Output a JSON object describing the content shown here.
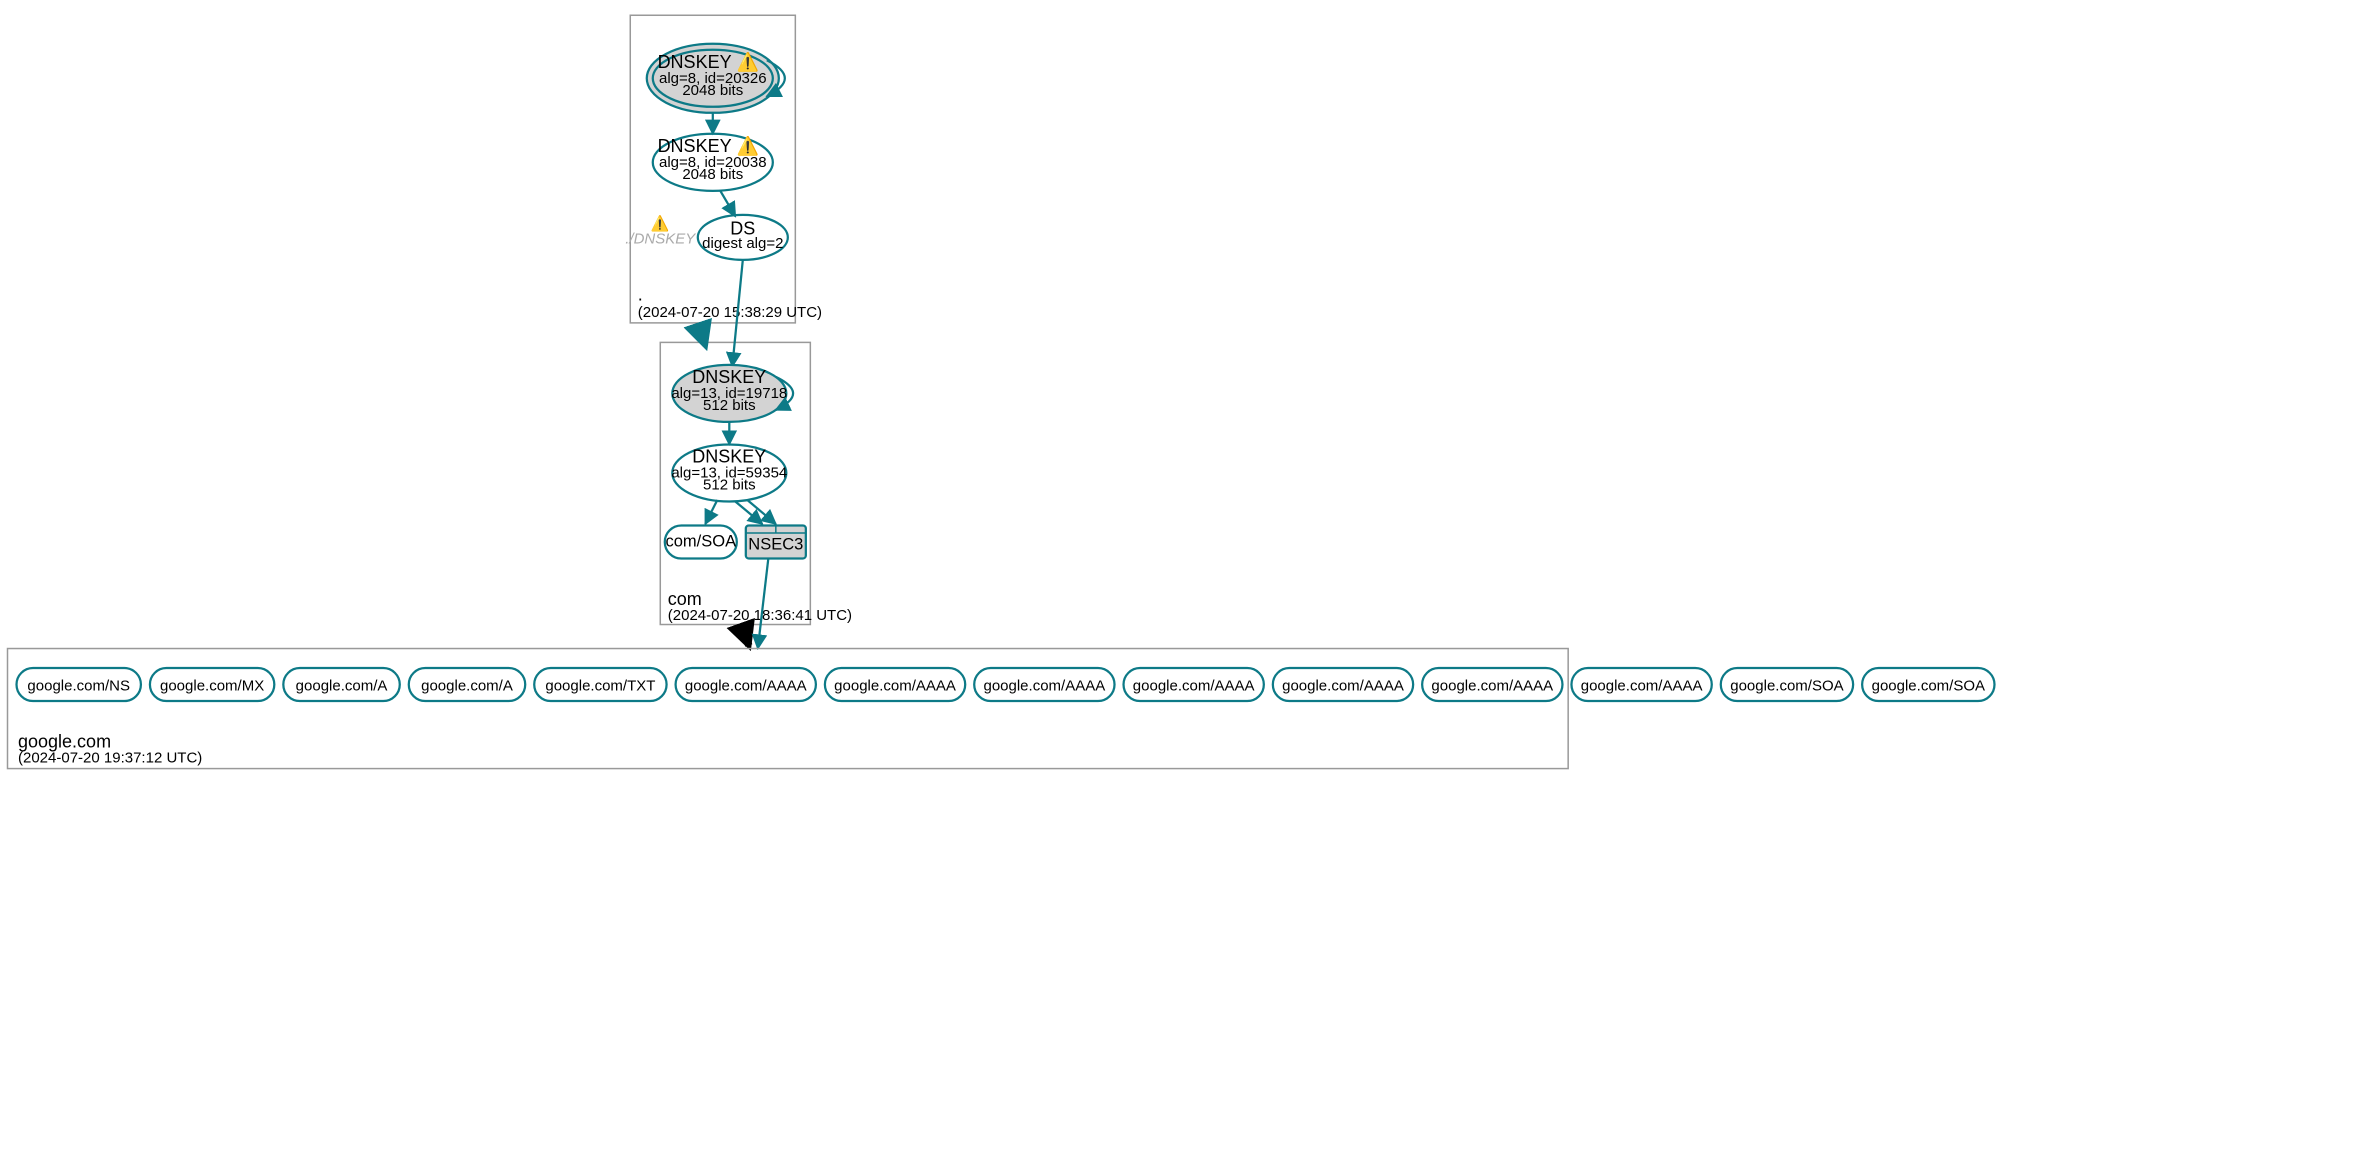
{
  "root_zone": {
    "label": ".",
    "timestamp": "(2024-07-20 15:38:29 UTC)",
    "ksk": {
      "title": "DNSKEY",
      "warning": "⚠️",
      "line1": "alg=8, id=20326",
      "line2": "2048 bits"
    },
    "zsk": {
      "title": "DNSKEY",
      "warning": "⚠️",
      "line1": "alg=8, id=20038",
      "line2": "2048 bits"
    },
    "ds": {
      "title": "DS",
      "line1": "digest alg=2"
    },
    "hidden_dnskey": "./DNSKEY",
    "hidden_warning": "⚠️"
  },
  "com_zone": {
    "label": "com",
    "timestamp": "(2024-07-20 18:36:41 UTC)",
    "ksk": {
      "title": "DNSKEY",
      "line1": "alg=13, id=19718",
      "line2": "512 bits"
    },
    "zsk": {
      "title": "DNSKEY",
      "line1": "alg=13, id=59354",
      "line2": "512 bits"
    },
    "soa": "com/SOA",
    "nsec3": "NSEC3"
  },
  "google_zone": {
    "label": "google.com",
    "timestamp": "(2024-07-20 19:37:12 UTC)",
    "records": [
      "google.com/NS",
      "google.com/MX",
      "google.com/A",
      "google.com/A",
      "google.com/TXT",
      "google.com/AAAA",
      "google.com/AAAA",
      "google.com/AAAA",
      "google.com/AAAA",
      "google.com/AAAA",
      "google.com/AAAA",
      "google.com/AAAA",
      "google.com/SOA",
      "google.com/SOA"
    ]
  }
}
